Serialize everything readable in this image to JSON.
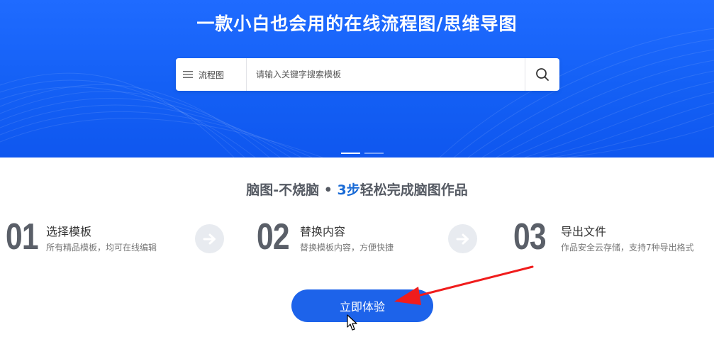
{
  "hero": {
    "title": "一款小白也会用的在线流程图/思维导图",
    "search": {
      "category": "流程图",
      "placeholder": "请输入关键字搜索模板"
    },
    "carousel_dots": 2,
    "active_dot": 0
  },
  "subtitle": {
    "part1": "脑图-不烧脑",
    "separator": "•",
    "highlight": "3步",
    "part2": "轻松完成脑图作品"
  },
  "steps": [
    {
      "num": "01",
      "title": "选择模板",
      "desc": "所有精品模板，均可在线编辑"
    },
    {
      "num": "02",
      "title": "替换内容",
      "desc": "替换模板内容，方便快捷"
    },
    {
      "num": "03",
      "title": "导出文件",
      "desc": "作品安全云存储，支持7种导出格式"
    }
  ],
  "cta_label": "立即体验",
  "colors": {
    "brand": "#1d63ea",
    "hero_bg": "#1460f5",
    "annotation_arrow": "#f01c1c"
  },
  "icons": {
    "menu": "menu-icon",
    "search": "search-icon",
    "step_arrow": "arrow-right-circle-icon",
    "cursor": "mouse-cursor-icon"
  }
}
